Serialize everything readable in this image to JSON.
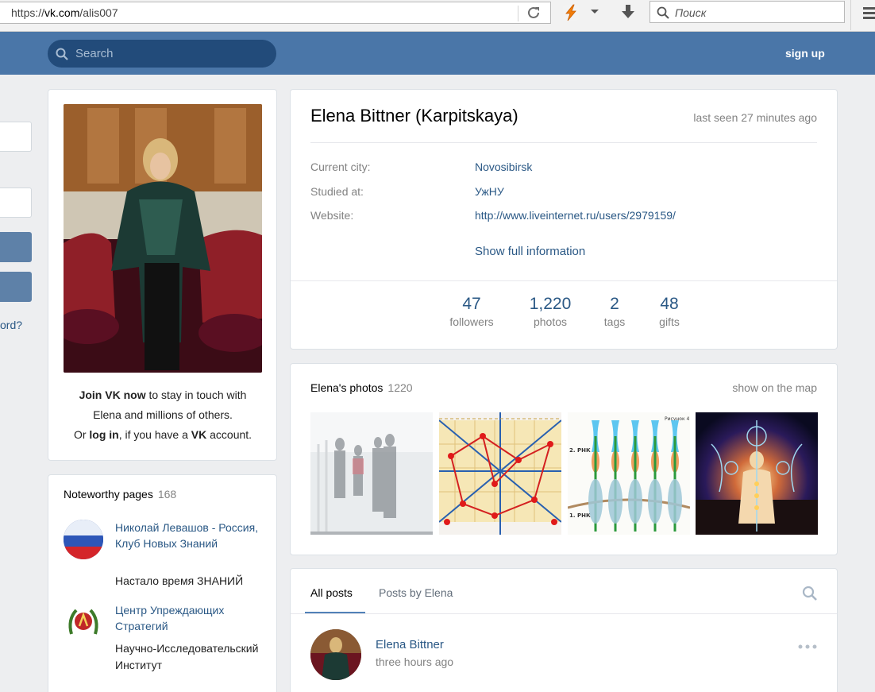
{
  "browser": {
    "url_scheme": "https://",
    "url_host": "vk.com",
    "url_path": "/alis007",
    "search_placeholder": "Поиск"
  },
  "header": {
    "search_placeholder": "Search",
    "signup_label": "sign up"
  },
  "left_edge": {
    "link_text": "ord?"
  },
  "profile": {
    "name": "Elena Bittner (Karpitskaya)",
    "last_seen": "last seen 27 minutes ago",
    "info": [
      {
        "label": "Current city:",
        "value": "Novosibirsk"
      },
      {
        "label": "Studied at:",
        "value": "УжНУ"
      },
      {
        "label": "Website:",
        "value": "http://www.liveinternet.ru/users/2979159/"
      }
    ],
    "show_full": "Show full information",
    "counters": [
      {
        "num": "47",
        "label": "followers"
      },
      {
        "num": "1,220",
        "label": "photos"
      },
      {
        "num": "2",
        "label": "tags"
      },
      {
        "num": "48",
        "label": "gifts"
      }
    ]
  },
  "join": {
    "join_vk_now": "Join VK now",
    "line1_rest": " to stay in touch with",
    "line2": "Elena and millions of others.",
    "or": "Or ",
    "log_in": "log in",
    "if_you_have": ", if you have a ",
    "vk": "VK",
    "account": " account."
  },
  "noteworthy": {
    "title": "Noteworthy pages",
    "count": "168",
    "items": [
      {
        "name": "Николай Левашов - Россия, Клуб Новых Знаний",
        "desc": "Настало время ЗНАНИЙ"
      },
      {
        "name": "Центр Упреждающих Стратегий",
        "desc": "Научно-Исследовательский Институт"
      }
    ]
  },
  "photos": {
    "title": "Elena's photos",
    "count": "1220",
    "show_map": "show on the map",
    "thumbs": [
      "photo-street",
      "photo-geometry",
      "photo-diagram",
      "photo-energy"
    ],
    "diagram_labels": [
      "Рисунок 4",
      "2. РНК",
      "1. РНК"
    ]
  },
  "posts": {
    "tab_all": "All posts",
    "tab_by": "Posts by Elena",
    "author": "Elena Bittner",
    "time": "three hours ago"
  }
}
